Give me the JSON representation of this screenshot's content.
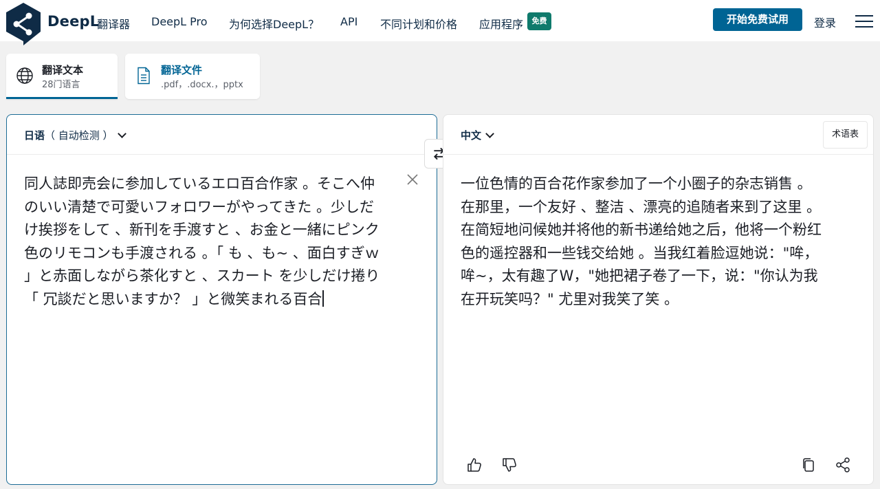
{
  "brand": {
    "name": "DeepL",
    "product": "翻译器"
  },
  "nav": {
    "items": [
      "DeepL Pro",
      "为何选择DeepL？",
      "API",
      "不同计划和价格",
      "应用程序"
    ],
    "badge": "免费",
    "cta": "开始免费试用",
    "login": "登录"
  },
  "tabs": {
    "text": {
      "title": "翻译文本",
      "sub": "28门语言"
    },
    "file": {
      "title": "翻译文件",
      "sub": ".pdf，.docx.，pptx"
    }
  },
  "source": {
    "lang": "日语",
    "detect": "（ 自动检测 ）",
    "text": "同人誌即売会に参加しているエロ百合作家 。そこへ仲のいい清楚で可愛いフォロワーがやってきた 。少しだけ挨拶をして 、新刊を手渡すと 、お金と一緒にピンク色のリモコンも手渡される 。「 も 、も~ 、面白すぎｗ 」と赤面しながら茶化すと 、スカート を少しだけ捲り「 冗談だと思いますか？ 」と微笑まれる百合"
  },
  "target": {
    "lang": "中文",
    "glossary": "术语表",
    "text": "一位色情的百合花作家参加了一个小圈子的杂志销售 。在那里，一个友好 、整洁 、漂亮的追随者来到了这里 。在简短地问候她并将他的新书递给她之后，他将一个粉红色的遥控器和一些钱交给她 。当我红着脸逗她说：\"哞，哞~，太有趣了W，\"她把裙子卷了一下，说：\"你认为我在开玩笑吗？\" 尤里对我笑了笑 。"
  },
  "colors": {
    "accent": "#006494",
    "brand_dark": "#0f2b46",
    "badge": "#0f7a6c"
  },
  "icons": [
    "deepl-logo-icon",
    "globe-icon",
    "document-icon",
    "close-icon",
    "swap-icon",
    "thumbs-up-icon",
    "thumbs-down-icon",
    "copy-icon",
    "share-icon",
    "menu-icon"
  ]
}
